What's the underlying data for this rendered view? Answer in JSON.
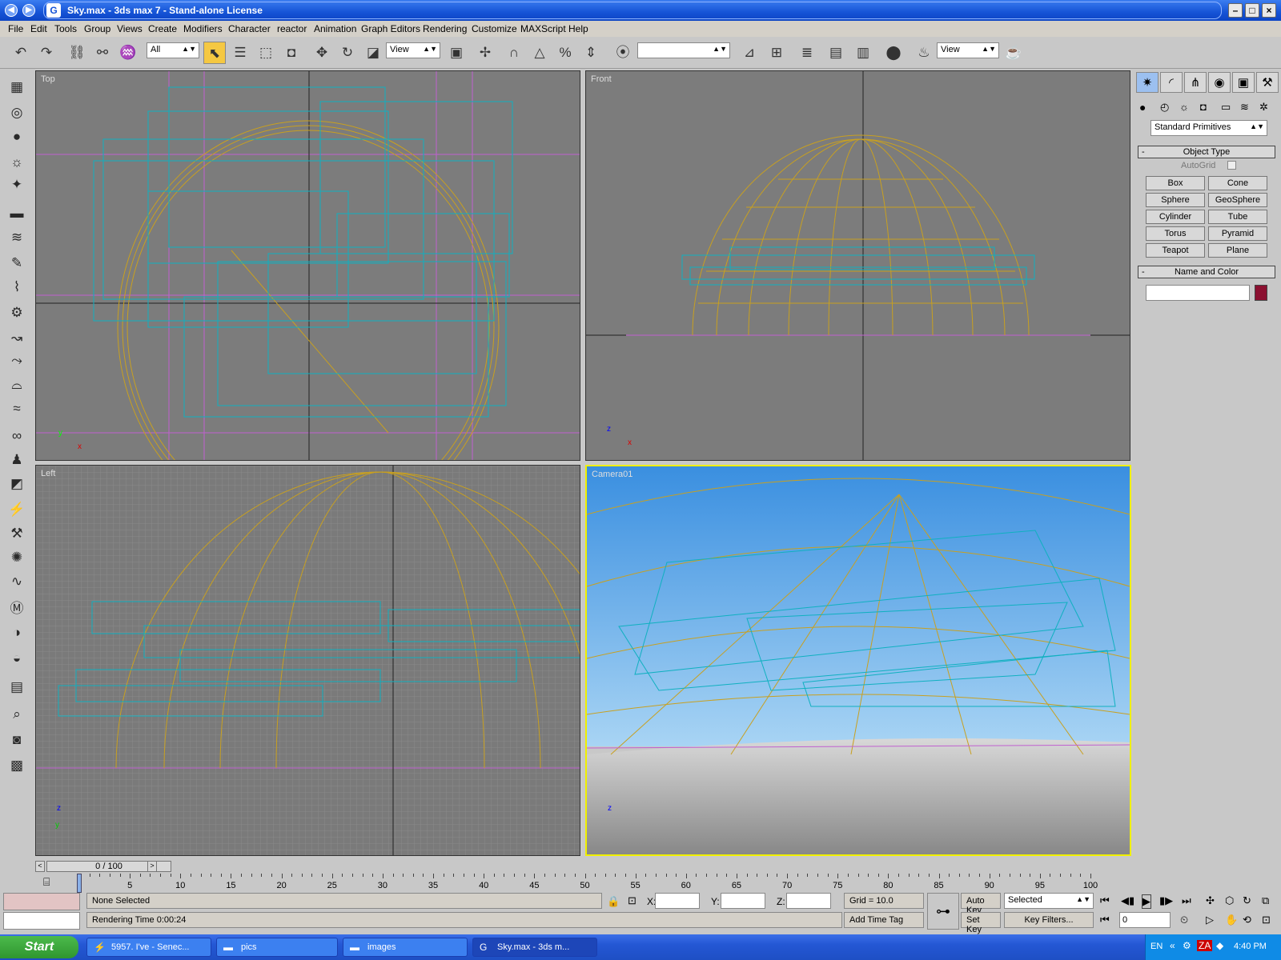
{
  "window": {
    "title": "Sky.max - 3ds max 7 - Stand-alone License"
  },
  "menu": [
    "File",
    "Edit",
    "Tools",
    "Group",
    "Views",
    "Create",
    "Modifiers",
    "Character",
    "reactor",
    "Animation",
    "Graph Editors",
    "Rendering",
    "Customize",
    "MAXScript",
    "Help"
  ],
  "toolbar": {
    "selection_filter": "All",
    "ref_coord": "View",
    "named_sel": "",
    "render_view": "View"
  },
  "viewports": {
    "top": "Top",
    "front": "Front",
    "left": "Left",
    "camera": "Camera01"
  },
  "cmd_panel": {
    "category": "Standard Primitives",
    "object_type_header": "Object Type",
    "autogrid_label": "AutoGrid",
    "buttons": [
      "Box",
      "Cone",
      "Sphere",
      "GeoSphere",
      "Cylinder",
      "Tube",
      "Torus",
      "Pyramid",
      "Teapot",
      "Plane"
    ],
    "name_color_header": "Name and Color",
    "object_name": "",
    "object_color": "#8b1030"
  },
  "timeline": {
    "slider": "0 / 100",
    "ticks": [
      0,
      5,
      10,
      15,
      20,
      25,
      30,
      35,
      40,
      45,
      50,
      55,
      60,
      65,
      70,
      75,
      80,
      85,
      90,
      95,
      100
    ]
  },
  "status": {
    "selection": "None Selected",
    "prompt": "Rendering Time  0:00:24",
    "x_label": "X:",
    "y_label": "Y:",
    "z_label": "Z:",
    "x": "",
    "y": "",
    "z": "",
    "grid": "Grid = 10.0",
    "add_time_tag": "Add Time Tag",
    "auto_key": "Auto Key",
    "set_key": "Set Key",
    "key_mode": "Selected",
    "key_filters": "Key Filters...",
    "frame": "0"
  },
  "taskbar": {
    "start": "Start",
    "tasks": [
      "5957. I've - Senec...",
      "pics",
      "images",
      "Sky.max - 3ds m..."
    ],
    "lang": "EN",
    "clock": "4:40 PM"
  },
  "colors": {
    "accent": "#f0f000",
    "dome": "#c8a020",
    "boxes": "#10b0c0",
    "guides": "#c060d0"
  }
}
